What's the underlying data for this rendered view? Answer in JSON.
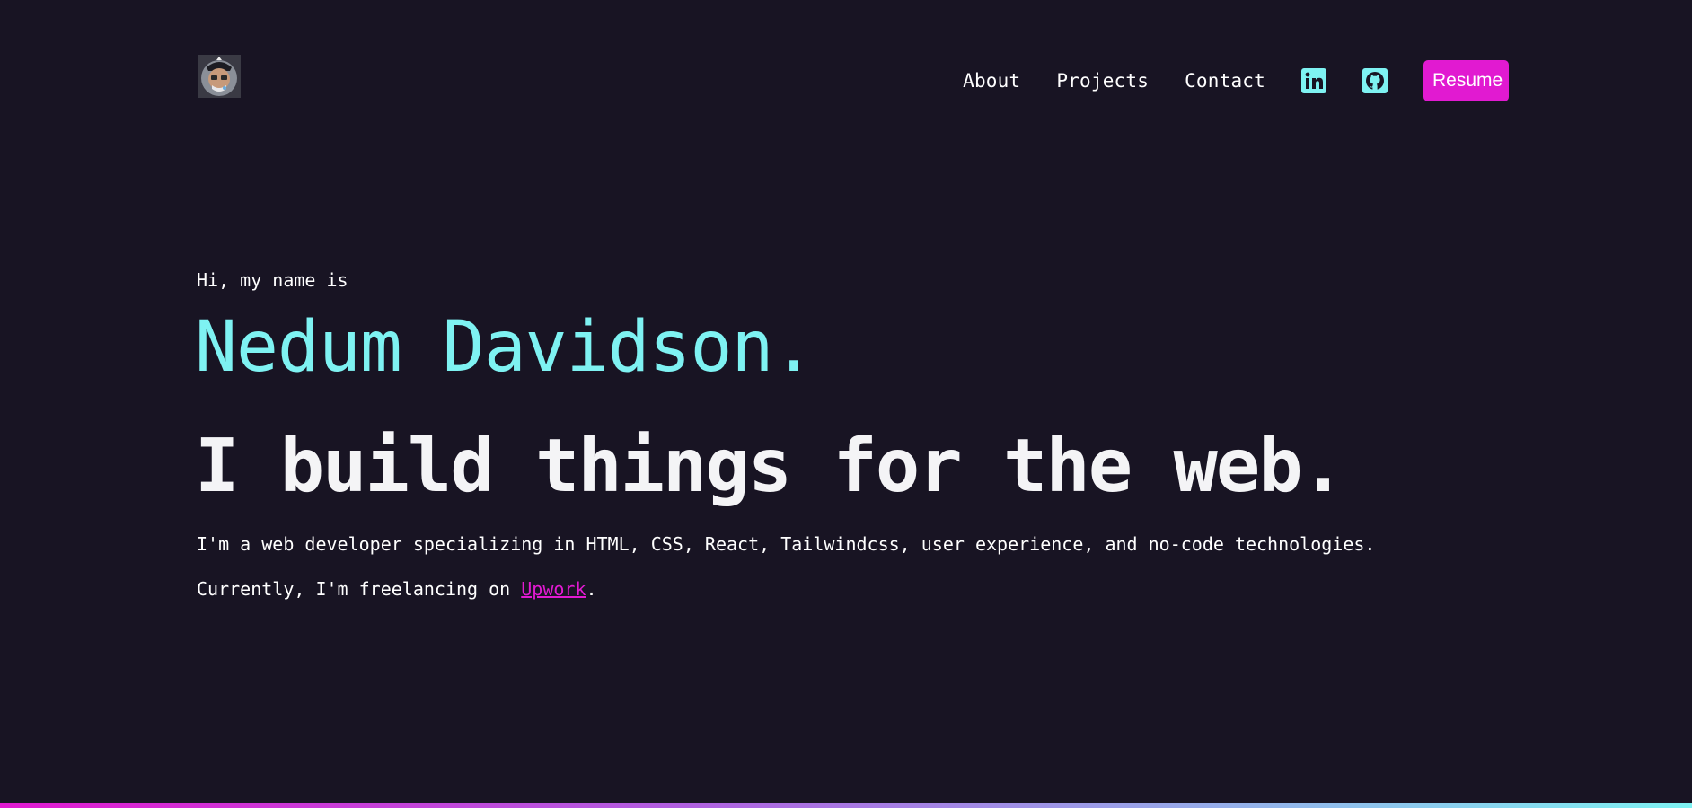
{
  "nav": {
    "links": [
      {
        "label": "About"
      },
      {
        "label": "Projects"
      },
      {
        "label": "Contact"
      }
    ],
    "social": [
      {
        "icon": "linkedin-icon"
      },
      {
        "icon": "github-icon"
      }
    ],
    "resume_label": "Resume"
  },
  "hero": {
    "greeting": "Hi, my name is",
    "name": "Nedum Davidson.",
    "tagline": "I build things for the web.",
    "description": "I'm a web developer specializing in HTML, CSS, React, Tailwindcss, user experience, and no-code technologies.",
    "freelance_prefix": "Currently, I'm freelancing on ",
    "freelance_link": "Upwork",
    "freelance_suffix": "."
  },
  "colors": {
    "background": "#181423",
    "accent_cyan": "#7ef2f2",
    "accent_magenta": "#e11ad1",
    "text": "#ffffff"
  }
}
